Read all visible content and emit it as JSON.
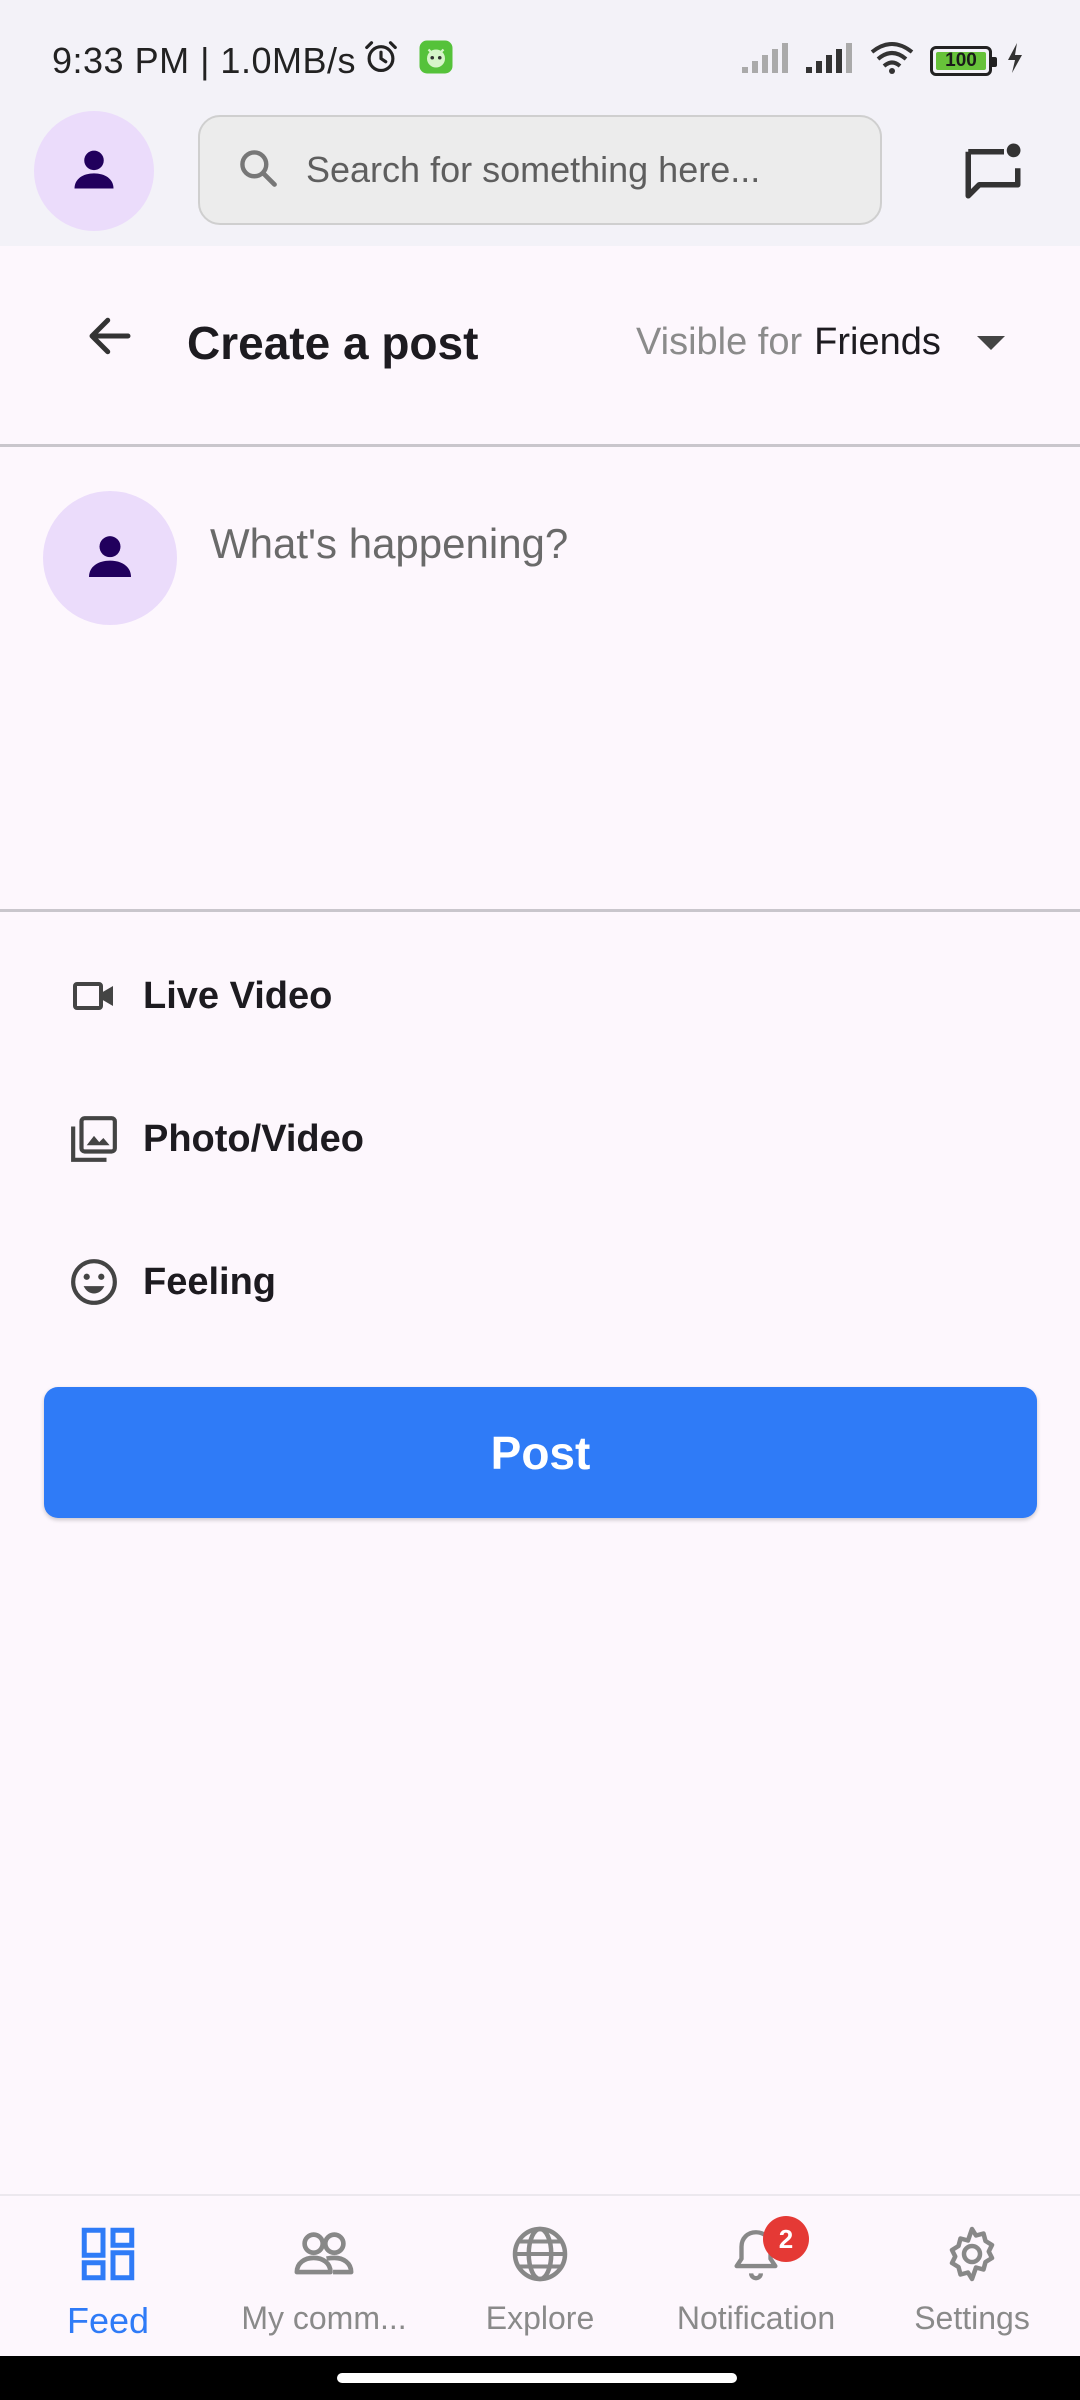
{
  "status_bar": {
    "time": "9:33 PM | 1.0MB/s",
    "battery": "100"
  },
  "header": {
    "search_placeholder": "Search for something here..."
  },
  "post": {
    "title": "Create a post",
    "visibility_prefix": "Visible for",
    "visibility_value": "Friends",
    "compose_placeholder": "What's happening?"
  },
  "options": [
    {
      "label": "Live Video",
      "icon": "video-camera-icon"
    },
    {
      "label": "Photo/Video",
      "icon": "photo-library-icon"
    },
    {
      "label": "Feeling",
      "icon": "smiley-icon"
    }
  ],
  "post_button": "Post",
  "nav": [
    {
      "label": "Feed",
      "icon": "dashboard-icon",
      "active": true
    },
    {
      "label": "My comm...",
      "icon": "people-icon"
    },
    {
      "label": "Explore",
      "icon": "globe-icon"
    },
    {
      "label": "Notification",
      "icon": "bell-icon",
      "badge": "2"
    },
    {
      "label": "Settings",
      "icon": "gear-icon"
    }
  ],
  "colors": {
    "accent": "#2f7bf7",
    "avatar_bg": "#ebdcfb",
    "badge": "#e53935"
  }
}
